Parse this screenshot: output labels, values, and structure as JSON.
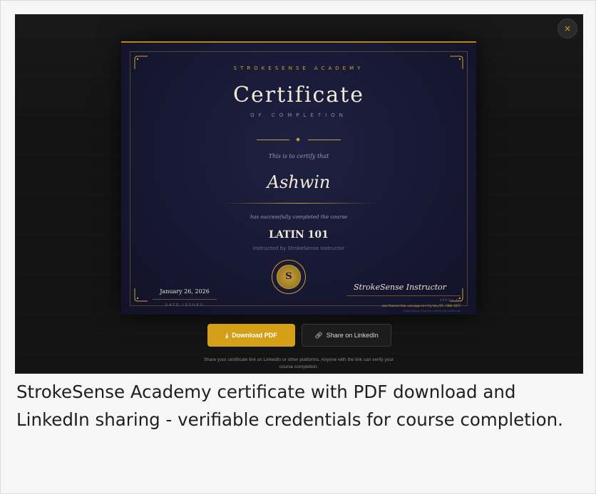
{
  "modal": {
    "close_icon": "×"
  },
  "certificate": {
    "academy": "STROKESENSE ACADEMY",
    "title": "Certificate",
    "subtitle": "OF COMPLETION",
    "certify_text": "This is to certify that",
    "recipient_name": "Ashwin",
    "completed_text": "has successfully completed the course",
    "course_name": "LATIN 101",
    "instructed_by": "Instructed by StrokeSense Instructor",
    "seal_letter": "S",
    "date_issued": "January 26, 2026",
    "date_label": "DATE ISSUED",
    "signature": "StrokeSense Instructor",
    "verify_label": "VERIFY AT",
    "verify_url": "smartbannerhub.com/app/verify/dev/55-7388-5877",
    "verify_note": "Smart Banner Hub has verified this certificate"
  },
  "actions": {
    "download_label": "Download PDF",
    "download_icon": "download-icon",
    "share_label": "Share on LinkedIn",
    "share_icon": "link-icon"
  },
  "share_note": "Share your certificate link on LinkedIn or other platforms. Anyone with the link can verify your course completion.",
  "caption": "StrokeSense Academy certificate with PDF download and LinkedIn sharing - verifiable credentials for course completion.",
  "colors": {
    "accent_gold": "#d4a017",
    "certificate_bg": "#1a1b38",
    "backdrop": "#141414"
  }
}
